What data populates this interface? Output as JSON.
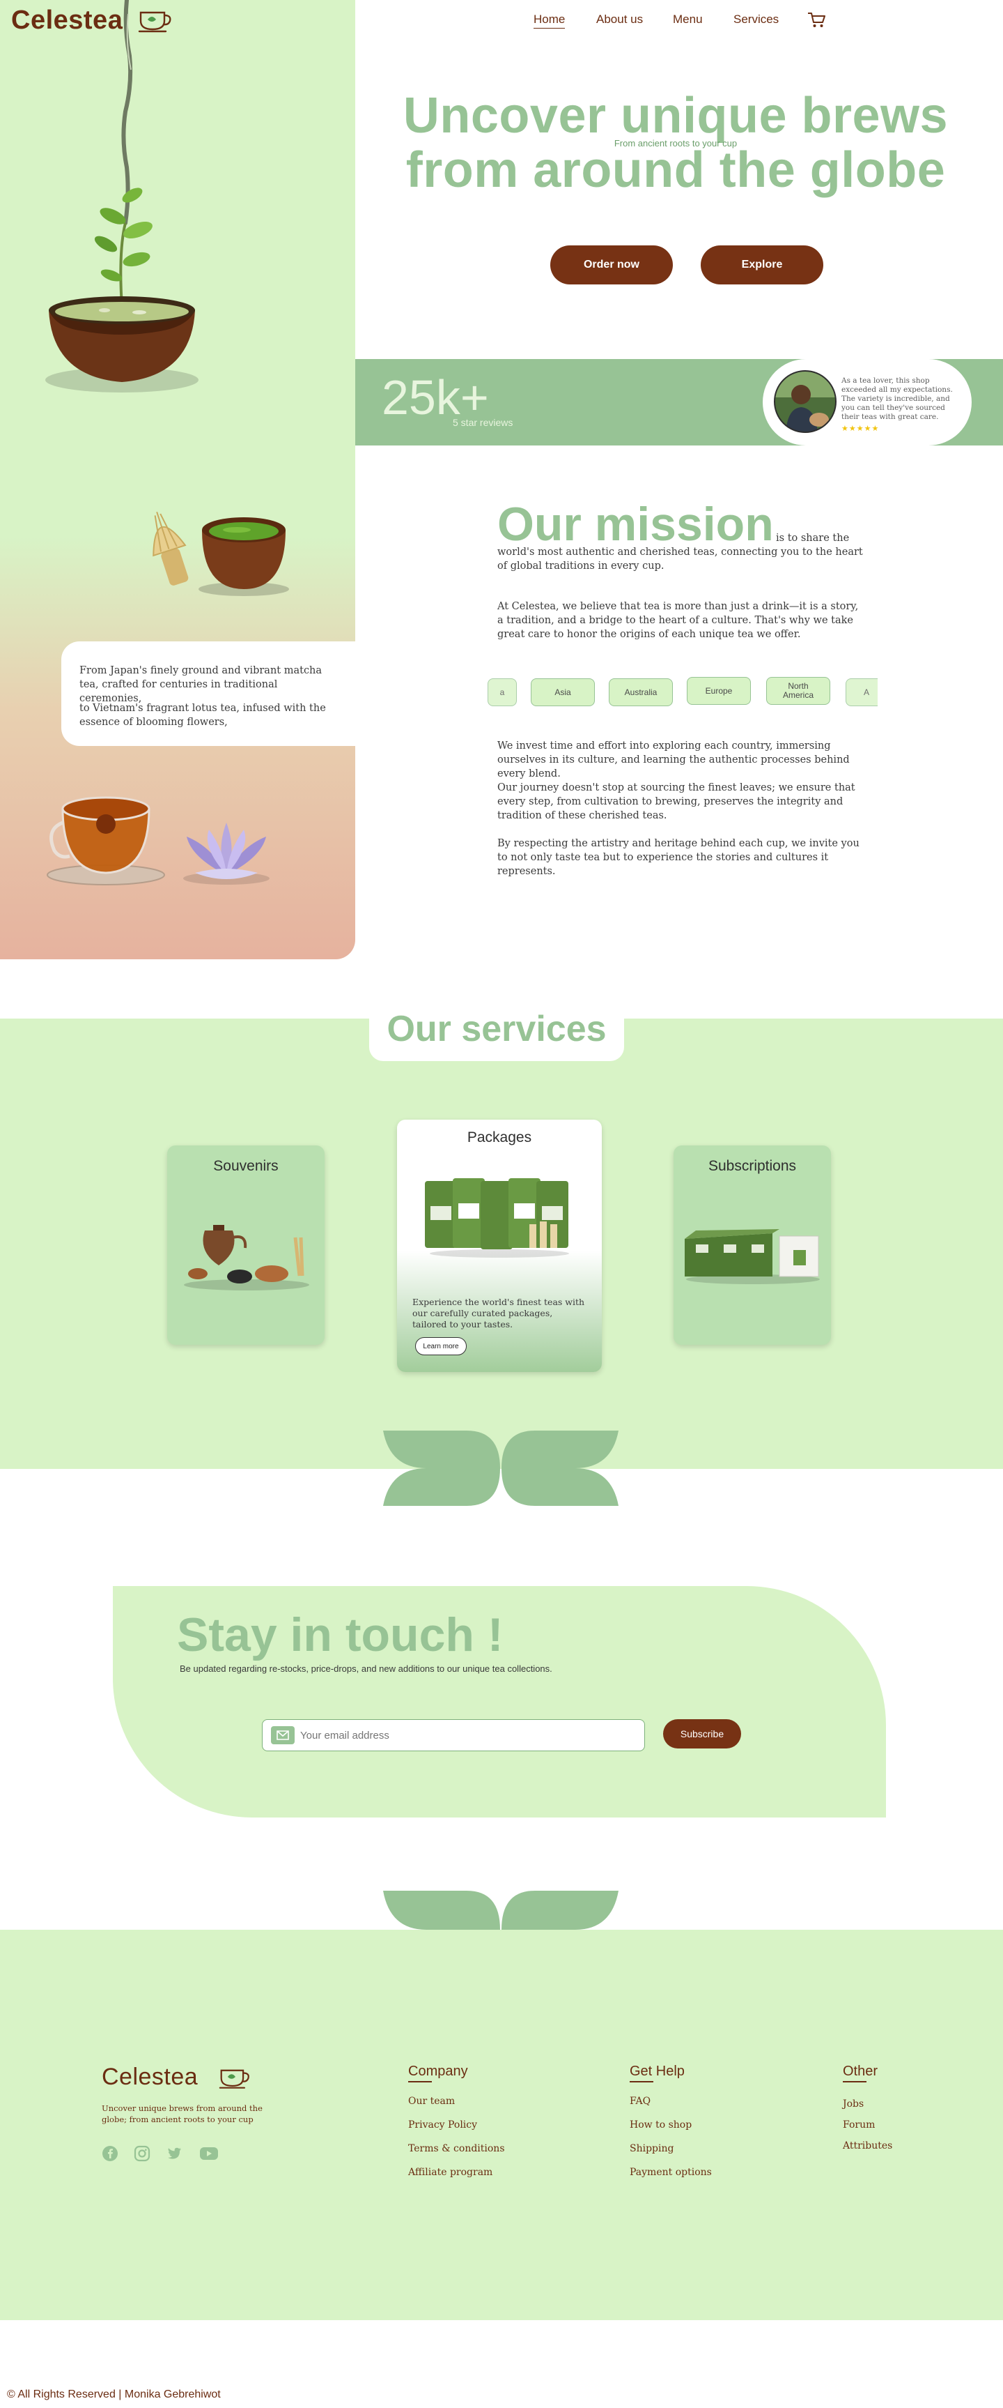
{
  "brand": {
    "name": "Celestea"
  },
  "nav": {
    "items": [
      "Home",
      "About us",
      "Menu",
      "Services"
    ],
    "active": "Home",
    "cart_icon": "cart-icon"
  },
  "hero": {
    "title_line1": "Uncover unique brews",
    "title_line2": "from around the globe",
    "subtitle": "From ancient roots to your cup",
    "order_btn": "Order now",
    "explore_btn": "Explore"
  },
  "reviews": {
    "count": "25k+",
    "label": "5 star reviews",
    "quote": "As a tea lover, this shop exceeded all my expectations. The variety is incredible, and you can tell they've sourced their teas with great care.",
    "stars": "★★★★★",
    "rating": 5
  },
  "left_panel": {
    "card_p1": "From Japan's finely ground and vibrant matcha tea, crafted for centuries in traditional ceremonies,",
    "card_p2": "to Vietnam's fragrant lotus tea, infused with the essence of blooming flowers,"
  },
  "mission": {
    "title": "Our mission",
    "lead_inline": "is to share the",
    "lead_rest": "world's most authentic and cherished teas, connecting you to the heart of global traditions in every cup.",
    "p2": "At Celestea, we believe that tea is more than just a drink—it is a story, a tradition, and a bridge to the heart of a culture. That's why we take great care to honor the origins of each unique tea we offer.",
    "regions": [
      "a",
      "Asia",
      "Australia",
      "Europe",
      "North America",
      "A"
    ],
    "p3": "We invest time and effort into exploring each country, immersing ourselves in its culture, and learning the authentic processes behind every blend.",
    "p4": "Our journey doesn't stop at sourcing the finest leaves; we ensure that every step, from cultivation to brewing, preserves the integrity and tradition of these cherished teas.",
    "p5": "By respecting the artistry and heritage behind each cup, we invite you to not only taste tea but to experience the stories and cultures it represents."
  },
  "services": {
    "title": "Our services",
    "cards": [
      {
        "title": "Souvenirs"
      },
      {
        "title": "Packages",
        "desc": "Experience the world's finest teas with our carefully curated packages, tailored to your tastes.",
        "btn": "Learn more"
      },
      {
        "title": "Subscriptions"
      }
    ]
  },
  "newsletter": {
    "title": "Stay in touch !",
    "subtitle": "Be updated regarding re-stocks, price-drops, and new additions to our unique tea collections.",
    "placeholder": "Your email address",
    "btn": "Subscribe"
  },
  "footer": {
    "tagline": "Uncover unique brews from around the globe; from ancient roots to your cup",
    "columns": [
      {
        "title": "Company",
        "links": [
          "Our team",
          "Privacy Policy",
          "Terms & conditions",
          "Affiliate program"
        ]
      },
      {
        "title": "Get Help",
        "links": [
          "FAQ",
          "How to shop",
          "Shipping",
          "Payment options"
        ]
      },
      {
        "title": "Other",
        "links": [
          "Jobs",
          "Forum",
          "Attributes"
        ]
      }
    ],
    "socials": [
      "facebook-icon",
      "instagram-icon",
      "twitter-icon",
      "youtube-icon"
    ],
    "copyright": "© All Rights Reserved | Monika Gebrehiwot"
  },
  "colors": {
    "brown": "#773214",
    "green_light": "#d8f3c6",
    "green_mid": "#97c395",
    "green_text": "#6a9e6a"
  }
}
